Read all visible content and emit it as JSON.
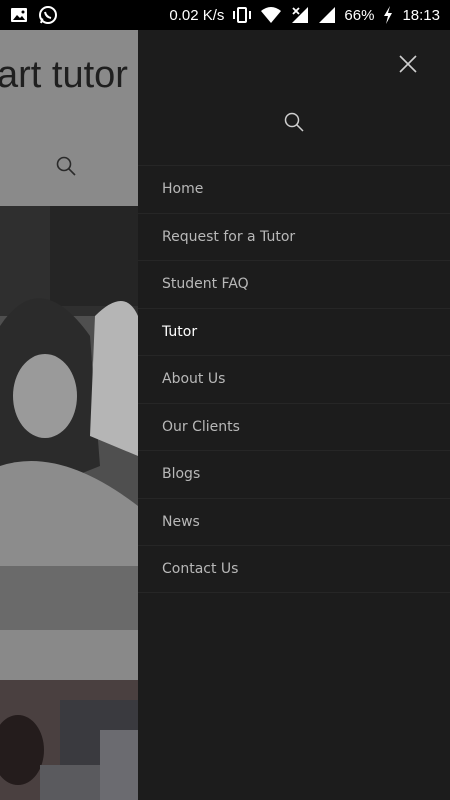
{
  "status_bar": {
    "speed": "0.02 K/s",
    "battery": "66%",
    "time": "18:13",
    "icons": [
      "image-icon",
      "whatsapp-icon",
      "vibrate-icon",
      "wifi-icon",
      "signal-icon",
      "signal-icon",
      "charging-icon"
    ]
  },
  "background": {
    "title": "art tutor"
  },
  "drawer": {
    "menu": [
      {
        "label": "Home"
      },
      {
        "label": "Request for a Tutor"
      },
      {
        "label": "Student FAQ"
      },
      {
        "label": "Tutor"
      },
      {
        "label": "About Us"
      },
      {
        "label": "Our Clients"
      },
      {
        "label": "Blogs"
      },
      {
        "label": "News"
      },
      {
        "label": "Contact Us"
      }
    ],
    "active_item": "Tutor"
  },
  "colors": {
    "drawer_bg": "#1c1c1c",
    "menu_text": "#b8b8b8",
    "menu_active": "#ffffff"
  }
}
